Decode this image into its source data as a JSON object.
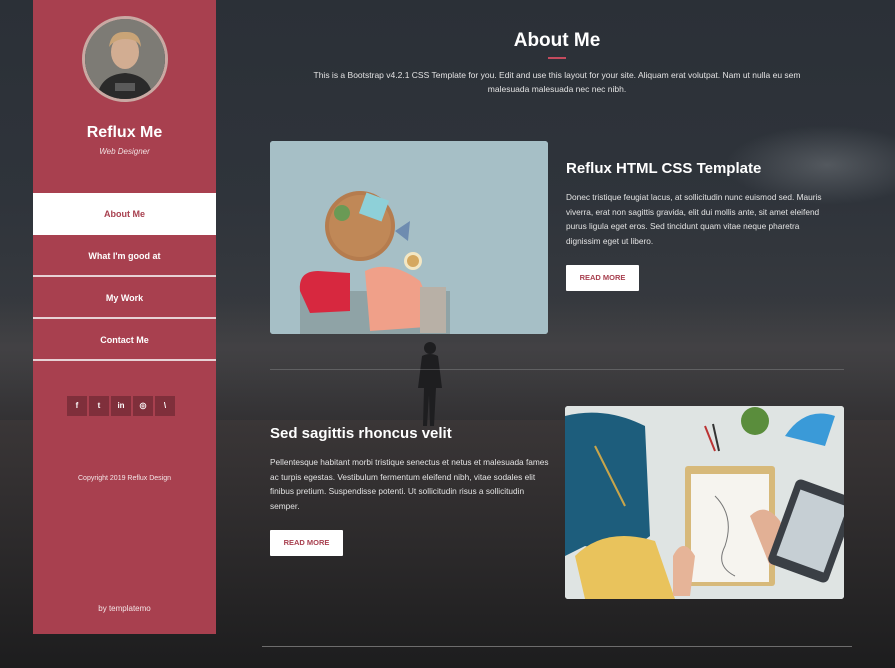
{
  "sidebar": {
    "name": "Reflux Me",
    "role": "Web Designer",
    "nav": [
      {
        "label": "About Me"
      },
      {
        "label": "What I'm good at"
      },
      {
        "label": "My Work"
      },
      {
        "label": "Contact Me"
      }
    ],
    "social": [
      {
        "icon": "facebook-icon",
        "glyph": "f"
      },
      {
        "icon": "twitter-icon",
        "glyph": "t"
      },
      {
        "icon": "linkedin-icon",
        "glyph": "in"
      },
      {
        "icon": "dribbble-icon",
        "glyph": "◎"
      },
      {
        "icon": "rss-icon",
        "glyph": "\\"
      }
    ],
    "copyright": "Copyright 2019 Reflux Design",
    "byline": "by templatemo"
  },
  "main": {
    "title": "About Me",
    "intro": "This is a Bootstrap v4.2.1 CSS Template for you. Edit and use this layout for your site. Aliquam erat volutpat. Nam ut nulla eu sem malesuada malesuada nec nec nibh.",
    "cards": [
      {
        "title": "Reflux HTML CSS Template",
        "text": "Donec tristique feugiat lacus, at sollicitudin nunc euismod sed. Mauris viverra, erat non sagittis gravida, elit dui mollis ante, sit amet eleifend purus ligula eget eros. Sed tincidunt quam vitae neque pharetra dignissim eget ut libero.",
        "button": "READ MORE"
      },
      {
        "title": "Sed sagittis rhoncus velit",
        "text": "Pellentesque habitant morbi tristique senectus et netus et malesuada fames ac turpis egestas. Vestibulum fermentum eleifend nibh, vitae sodales elit finibus pretium. Suspendisse potenti. Ut sollicitudin risus a sollicitudin semper.",
        "button": "READ MORE"
      }
    ]
  },
  "colors": {
    "accent": "#a8404f",
    "social_bg": "#7f2f3b",
    "background": "#2f343b"
  }
}
